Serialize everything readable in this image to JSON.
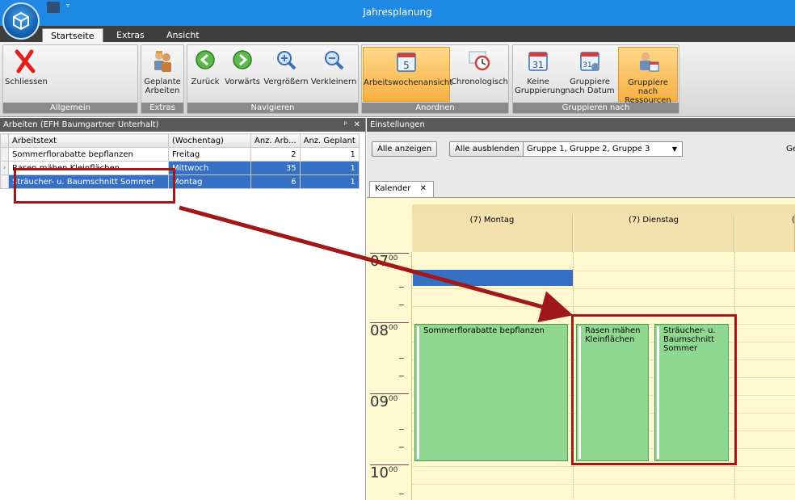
{
  "window": {
    "title": "Jahresplanung"
  },
  "tabs": [
    {
      "label": "Startseite",
      "active": true
    },
    {
      "label": "Extras",
      "active": false
    },
    {
      "label": "Ansicht",
      "active": false
    }
  ],
  "ribbon": {
    "groups": [
      {
        "label": "Allgemein",
        "buttons": [
          {
            "label": "Schliessen",
            "icon": "close-x-icon"
          }
        ]
      },
      {
        "label": "Extras",
        "buttons": [
          {
            "label": "Geplante Arbeiten",
            "icon": "workers-icon"
          }
        ]
      },
      {
        "label": "Navigieren",
        "buttons": [
          {
            "label": "Zurück",
            "icon": "back-arrow-icon"
          },
          {
            "label": "Vorwärts",
            "icon": "forward-arrow-icon"
          },
          {
            "label": "Vergrößern",
            "icon": "zoom-in-icon"
          },
          {
            "label": "Verkleinern",
            "icon": "zoom-out-icon"
          }
        ]
      },
      {
        "label": "Anordnen",
        "buttons": [
          {
            "label": "Arbeitswochenansicht",
            "icon": "workweek-calendar-icon",
            "selected": true
          },
          {
            "label": "Chronologisch",
            "icon": "chronological-icon"
          }
        ]
      },
      {
        "label": "Gruppieren nach",
        "buttons": [
          {
            "label": "Keine Gruppierung",
            "icon": "calendar-31-icon"
          },
          {
            "label": "Gruppiere nach Datum",
            "icon": "calendar-date-group-icon"
          },
          {
            "label": "Gruppiere nach Ressourcen",
            "icon": "resource-group-icon",
            "selected": true
          }
        ]
      }
    ]
  },
  "left_panel": {
    "title": "Arbeiten (EFH Baumgartner Unterhalt)",
    "pin": "ᵖ",
    "close": "✕",
    "columns": [
      "Arbeitstext",
      "(Wochentag)",
      "Anz. Arb...",
      "Anz. Geplant"
    ],
    "rows": [
      {
        "text": "Sommerflorabatte bepflanzen",
        "weekday": "Freitag",
        "count": "2",
        "planned": "1",
        "selected": false
      },
      {
        "text": "Rasen mähen Kleinflächen",
        "weekday": "Mittwoch",
        "count": "35",
        "planned": "1",
        "selected": true
      },
      {
        "text": "Sträucher- u. Baumschnitt Sommer",
        "weekday": "Montag",
        "count": "6",
        "planned": "1",
        "selected": true
      }
    ]
  },
  "settings": {
    "title": "Einstellungen",
    "show_all": "Alle anzeigen",
    "hide_all": "Alle ausblenden",
    "groups_value": "Gruppe 1, Gruppe 2, Gruppe 3",
    "cut_label": "Ge"
  },
  "calendar": {
    "tab_label": "Kalender",
    "tab_close": "✕",
    "days": [
      "(7) Montag",
      "(7) Dienstag",
      "("
    ],
    "hours": [
      {
        "h": "07",
        "m": "00"
      },
      {
        "h": "08",
        "m": "00"
      },
      {
        "h": "09",
        "m": "00"
      },
      {
        "h": "10",
        "m": "00"
      }
    ],
    "appointments": [
      {
        "text": "Sommerflorabatte bepflanzen"
      },
      {
        "text": "Rasen mähen Kleinflächen"
      },
      {
        "text": "Sträucher- u. Baumschnitt Sommer"
      }
    ]
  },
  "colors": {
    "titlebar": "#1e88e5",
    "selection": "#3570c4",
    "appointment": "#8fd88f",
    "highlight": "#a01818"
  }
}
